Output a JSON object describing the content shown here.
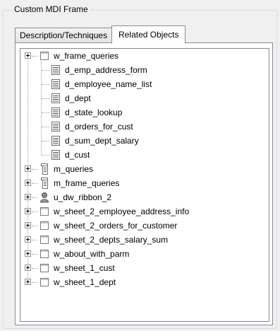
{
  "group": {
    "title": "Custom MDI Frame"
  },
  "tabs": [
    {
      "label": "Description/Techniques",
      "active": false
    },
    {
      "label": "Related Objects",
      "active": true
    }
  ],
  "tree": [
    {
      "label": "w_frame_queries",
      "icon": "window-icon",
      "expandable": true,
      "level": 0
    },
    {
      "label": "d_emp_address_form",
      "icon": "datawindow-icon",
      "expandable": false,
      "level": 1
    },
    {
      "label": "d_employee_name_list",
      "icon": "datawindow-icon",
      "expandable": false,
      "level": 1
    },
    {
      "label": "d_dept",
      "icon": "datawindow-icon",
      "expandable": false,
      "level": 1
    },
    {
      "label": "d_state_lookup",
      "icon": "datawindow-icon",
      "expandable": false,
      "level": 1
    },
    {
      "label": "d_orders_for_cust",
      "icon": "datawindow-icon",
      "expandable": false,
      "level": 1
    },
    {
      "label": "d_sum_dept_salary",
      "icon": "datawindow-icon",
      "expandable": false,
      "level": 1
    },
    {
      "label": "d_cust",
      "icon": "datawindow-icon",
      "expandable": false,
      "level": 1
    },
    {
      "label": "m_queries",
      "icon": "menu-icon",
      "expandable": true,
      "level": 0
    },
    {
      "label": "m_frame_queries",
      "icon": "menu-icon",
      "expandable": true,
      "level": 0
    },
    {
      "label": "u_dw_ribbon_2",
      "icon": "user-object-icon",
      "expandable": true,
      "level": 0
    },
    {
      "label": "w_sheet_2_employee_address_info",
      "icon": "window-icon",
      "expandable": true,
      "level": 0
    },
    {
      "label": "w_sheet_2_orders_for_customer",
      "icon": "window-icon",
      "expandable": true,
      "level": 0
    },
    {
      "label": "w_sheet_2_depts_salary_sum",
      "icon": "window-icon",
      "expandable": true,
      "level": 0
    },
    {
      "label": "w_about_with_parm",
      "icon": "window-icon",
      "expandable": true,
      "level": 0
    },
    {
      "label": "w_sheet_1_cust",
      "icon": "window-icon",
      "expandable": true,
      "level": 0
    },
    {
      "label": "w_sheet_1_dept",
      "icon": "window-icon",
      "expandable": true,
      "level": 0
    }
  ]
}
